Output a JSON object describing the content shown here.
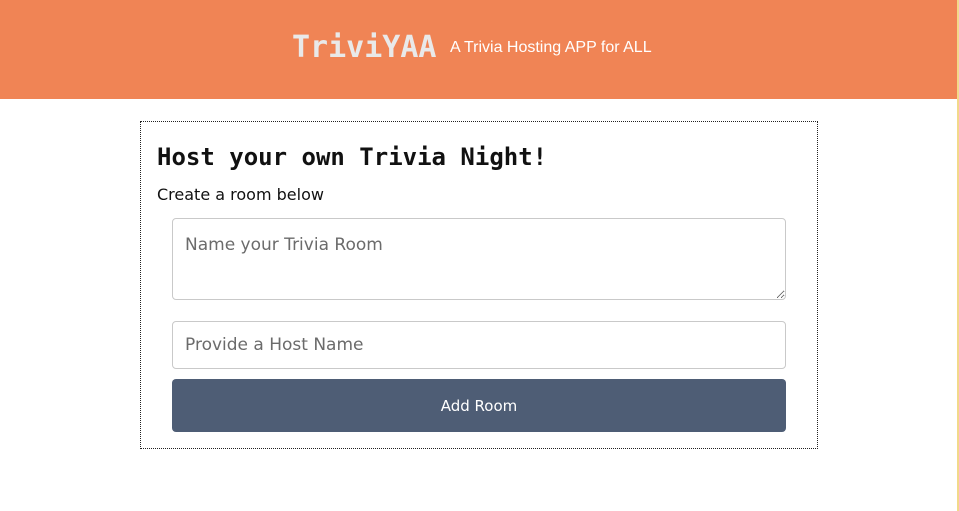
{
  "header": {
    "brand": "TriviYAA",
    "tagline": "A Trivia Hosting APP for ALL"
  },
  "create_room": {
    "title": "Host your own Trivia Night!",
    "subtitle": "Create a room below",
    "room_name_placeholder": "Name your Trivia Room",
    "room_name_value": "",
    "host_name_placeholder": "Provide a Host Name",
    "host_name_value": "",
    "submit_label": "Add Room"
  },
  "colors": {
    "header_bg": "#f08455",
    "button_bg": "#4e5d75",
    "brand_text": "#e9e9e9"
  }
}
